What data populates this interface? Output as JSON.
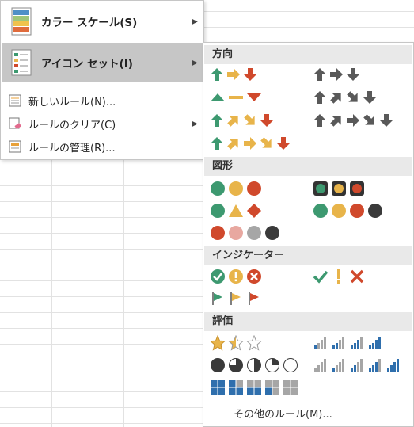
{
  "menu": {
    "color_scale": {
      "label": "カラー スケール(S)",
      "icon": "color-scale-icon"
    },
    "icon_sets": {
      "label": "アイコン セット(I)",
      "icon": "icon-sets-icon"
    },
    "new_rule": {
      "label": "新しいルール(N)..."
    },
    "clear_rules": {
      "label": "ルールのクリア(C)"
    },
    "manage_rules": {
      "label": "ルールの管理(R)..."
    }
  },
  "submenu": {
    "sections": {
      "directional": "方向",
      "shapes": "図形",
      "indicators": "インジケーター",
      "ratings": "評価"
    },
    "more_rules": "その他のルール(M)..."
  },
  "colors": {
    "green": "#3d9970",
    "yellow": "#e8b44a",
    "red": "#d0492c",
    "gray": "#595959",
    "blue": "#2f6fad"
  }
}
